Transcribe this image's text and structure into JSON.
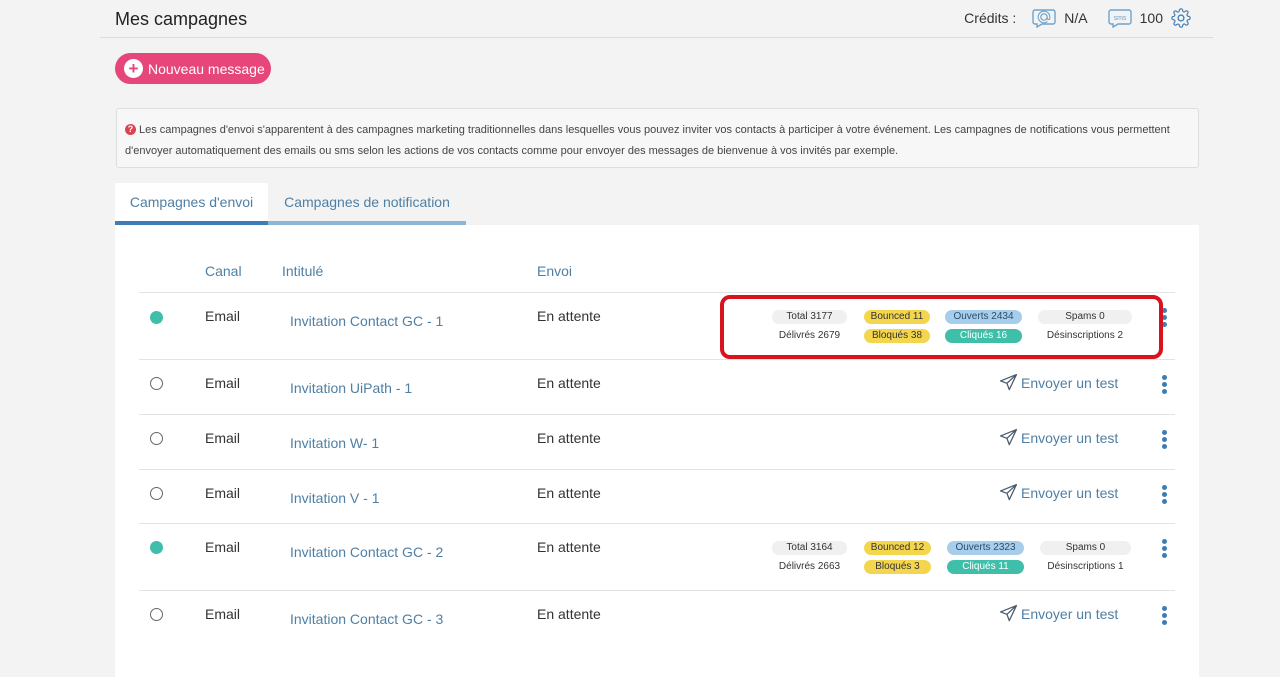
{
  "header": {
    "title": "Mes campagnes",
    "credits_label": "Crédits :",
    "credit_email_value": "N/A",
    "credit_sms_icon_text": "sms",
    "credit_sms_value": "100"
  },
  "actions": {
    "new_message": "Nouveau message"
  },
  "info": {
    "icon_text": "?",
    "text": "Les campagnes d'envoi s'apparentent à des campagnes marketing traditionnelles dans lesquelles vous pouvez inviter vos contacts à participer à votre événement. Les campagnes de notifications vous permettent d'envoyer automatiquement des emails ou sms selon les actions de vos contacts comme pour envoyer des messages de bienvenue à vos invités par exemple."
  },
  "tabs": [
    {
      "label": "Campagnes d'envoi",
      "active": true
    },
    {
      "label": "Campagnes de notification",
      "active": false
    }
  ],
  "table": {
    "headers": {
      "canal": "Canal",
      "intitule": "Intitulé",
      "envoi": "Envoi"
    },
    "send_test_label": "Envoyer un test",
    "rows": [
      {
        "active": true,
        "canal": "Email",
        "title": "Invitation Contact GC - 1",
        "status": "En attente",
        "stats": {
          "total": "Total 3177",
          "delivered": "Délivrés 2679",
          "bounced": "Bounced 11",
          "blocked": "Bloqués 38",
          "opened": "Ouverts 2434",
          "clicked": "Cliqués 16",
          "spams": "Spams 0",
          "unsub": "Désinscriptions 2"
        }
      },
      {
        "active": false,
        "canal": "Email",
        "title": "Invitation UiPath - 1",
        "status": "En attente"
      },
      {
        "active": false,
        "canal": "Email",
        "title": "Invitation W- 1",
        "status": "En attente"
      },
      {
        "active": false,
        "canal": "Email",
        "title": "Invitation V - 1",
        "status": "En attente"
      },
      {
        "active": true,
        "canal": "Email",
        "title": "Invitation Contact GC - 2",
        "status": "En attente",
        "stats": {
          "total": "Total 3164",
          "delivered": "Délivrés 2663",
          "bounced": "Bounced 12",
          "blocked": "Bloqués 3",
          "opened": "Ouverts 2323",
          "clicked": "Cliqués 11",
          "spams": "Spams 0",
          "unsub": "Désinscriptions 1"
        }
      },
      {
        "active": false,
        "canal": "Email",
        "title": "Invitation Contact GC - 3",
        "status": "En attente"
      }
    ]
  },
  "colors": {
    "accent": "#3e7db3",
    "pink_button": "#e6467a",
    "teal": "#3fbfa9",
    "yellow": "#f3d64e",
    "light_blue": "#a7cdec",
    "highlight_red": "#d8131f"
  }
}
